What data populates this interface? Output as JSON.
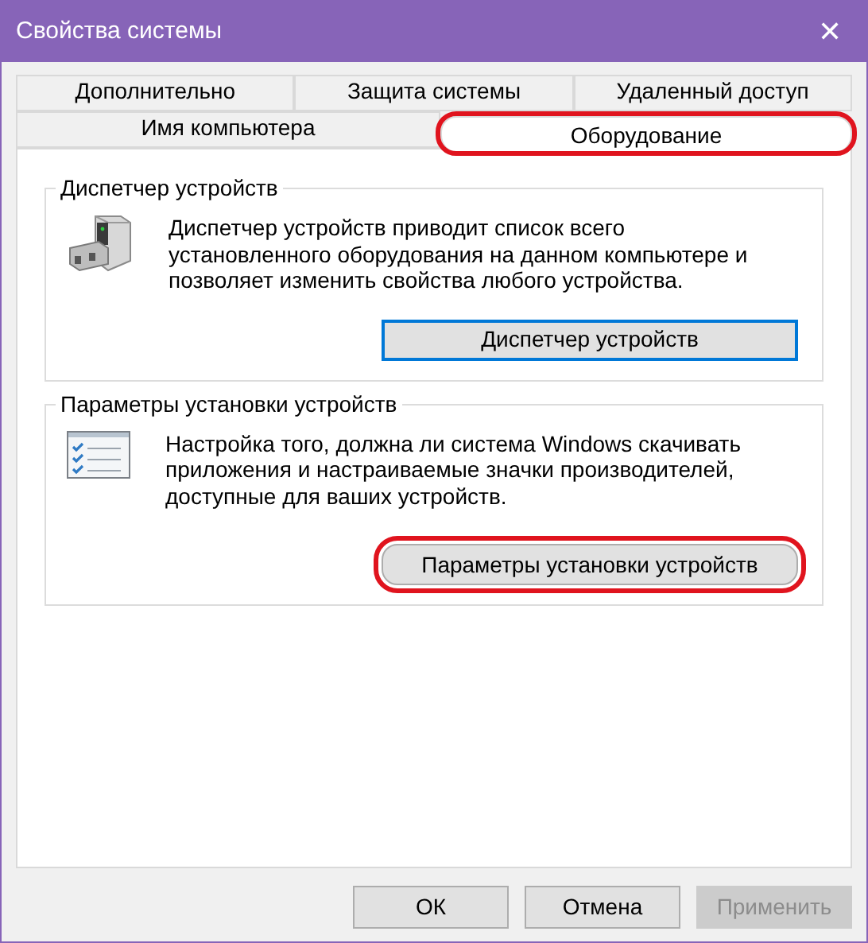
{
  "window": {
    "title": "Свойства системы",
    "close": "✕"
  },
  "tab_rows": [
    {
      "tabs": [
        {
          "label": "Дополнительно",
          "selected": false,
          "highlighted": false
        },
        {
          "label": "Защита системы",
          "selected": false,
          "highlighted": false
        },
        {
          "label": "Удаленный доступ",
          "selected": false,
          "highlighted": false
        }
      ]
    },
    {
      "tabs": [
        {
          "label": "Имя компьютера",
          "selected": false,
          "highlighted": false
        },
        {
          "label": "Оборудование",
          "selected": true,
          "highlighted": true
        }
      ]
    }
  ],
  "groups": [
    {
      "title": "Диспетчер устройств",
      "kind": "device-manager",
      "description": "Диспетчер устройств приводит список всего установленного оборудования на данном компьютере и позволяет изменить свойства любого устройства.",
      "button": {
        "label": "Диспетчер устройств",
        "focused": true,
        "highlighted": false
      }
    },
    {
      "title": "Параметры установки устройств",
      "kind": "checklist",
      "description": "Настройка того, должна ли система Windows скачивать приложения и настраиваемые значки производителей, доступные для ваших устройств.",
      "button": {
        "label": "Параметры установки устройств",
        "focused": false,
        "highlighted": true
      }
    }
  ],
  "buttons": [
    {
      "label": "ОК",
      "disabled": false
    },
    {
      "label": "Отмена",
      "disabled": false
    },
    {
      "label": "Применить",
      "disabled": true
    }
  ]
}
